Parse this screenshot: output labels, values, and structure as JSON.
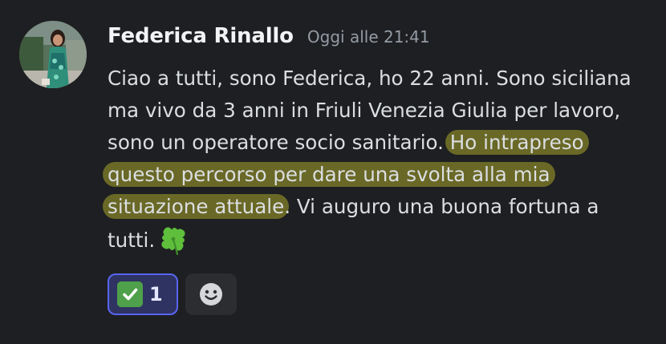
{
  "message": {
    "author": "Federica Rinallo",
    "timestamp": "Oggi alle 21:41",
    "lines": [
      "Ciao a tutti, sono Federica, ho 22 anni. Sono siciliana",
      "ma vivo da 3 anni in Friuli Venezia Giulia per lavoro,",
      "sono un operatore socio sanitario. ",
      "Ho intrapreso",
      "questo percorso per dare una svolta alla mia",
      "situazione attuale",
      ". Vi auguro una buona fortuna a",
      "tutti."
    ],
    "highlight_color": "#9c9a2a"
  },
  "reactions": [
    {
      "emoji": "white-check-mark",
      "count": "1",
      "active": true
    }
  ],
  "colors": {
    "background": "#1e1f22",
    "username": "#f2f3f5",
    "text": "#dbdee1",
    "timestamp": "#949ba4",
    "reaction_border": "#5865f2"
  }
}
